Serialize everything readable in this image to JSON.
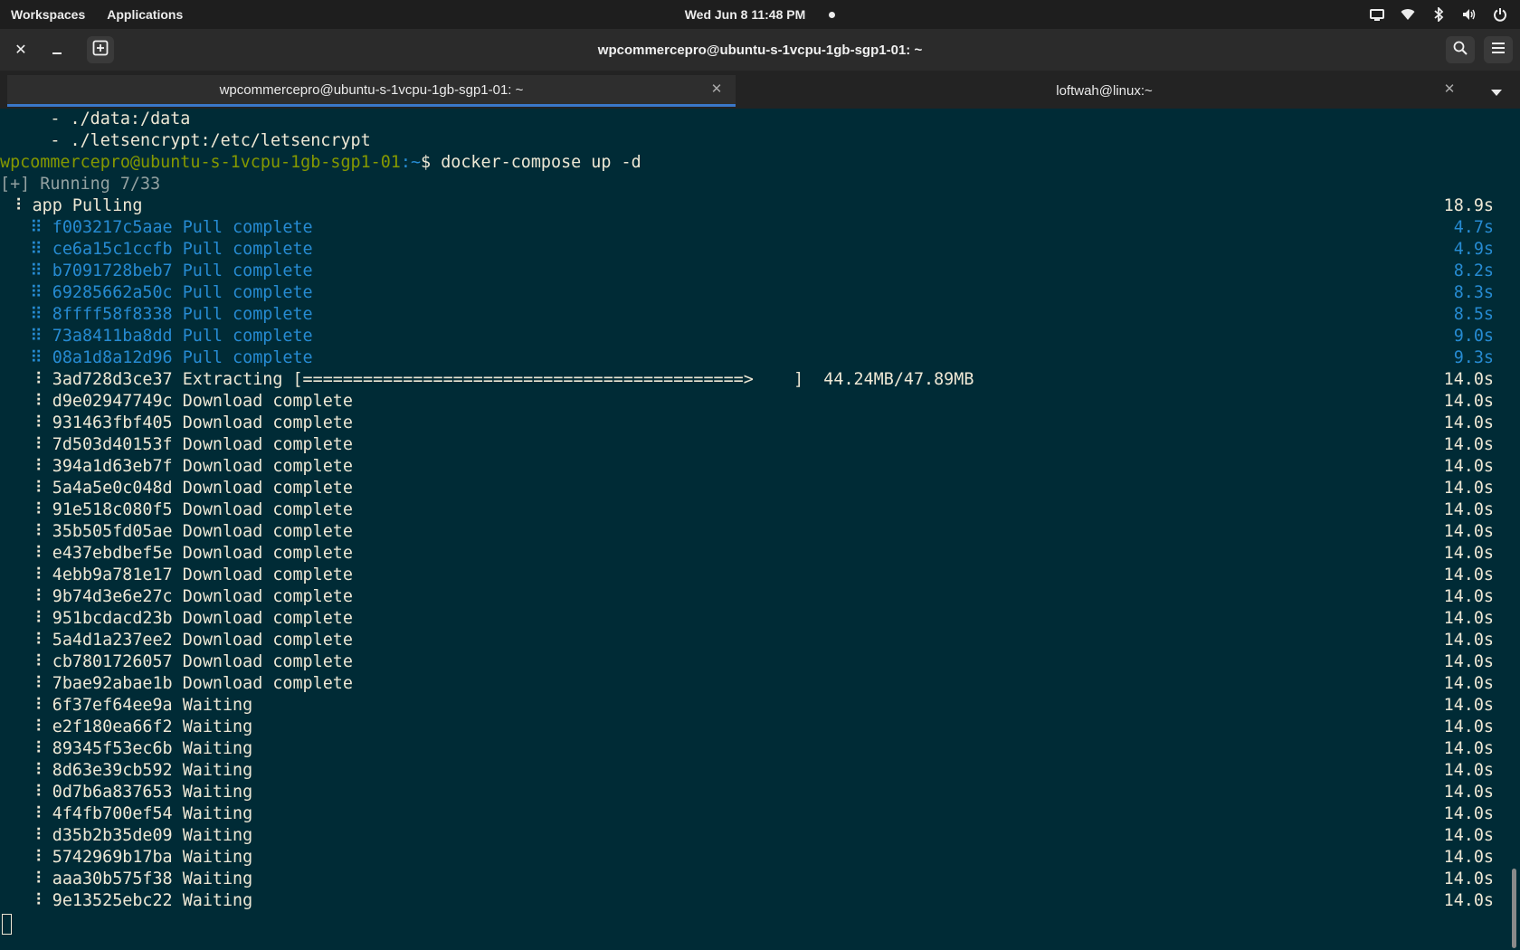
{
  "topbar": {
    "workspaces": "Workspaces",
    "applications": "Applications",
    "clock": "Wed Jun 8  11:48 PM",
    "tray_icons": [
      "screen-icon",
      "wifi-icon",
      "bluetooth-icon",
      "volume-icon",
      "power-icon"
    ]
  },
  "window": {
    "title": "wpcommercepro@ubuntu-s-1vcpu-1gb-sgp1-01: ~",
    "buttons": [
      "close-icon",
      "minimize-icon",
      "new-tab-icon",
      "search-icon",
      "menu-icon"
    ]
  },
  "tabs": [
    {
      "label": "wpcommercepro@ubuntu-s-1vcpu-1gb-sgp1-01: ~",
      "active": true
    },
    {
      "label": "loftwah@linux:~",
      "active": false
    }
  ],
  "colors": {
    "background": "#002b36",
    "blue": "#268bd2",
    "green": "#859900",
    "text": "#eee8d5",
    "accent": "#3a78c9"
  },
  "terminal": {
    "pre_lines": [
      "     - ./data:/data",
      "     - ./letsencrypt:/etc/letsencrypt"
    ],
    "prompt_user": "wpcommercepro@ubuntu-s-1vcpu-1gb-sgp1-01",
    "prompt_path": ":~",
    "prompt_sigil": "$ ",
    "command": "docker-compose up -d",
    "running": "[+] Running 7/33",
    "app_line": " ⠸ app Pulling",
    "app_time": "18.9s",
    "layers": [
      {
        "text": "   ⠿ f003217c5aae Pull complete",
        "time": "4.7s",
        "style": "blue"
      },
      {
        "text": "   ⠿ ce6a15c1ccfb Pull complete",
        "time": "4.9s",
        "style": "blue"
      },
      {
        "text": "   ⠿ b7091728beb7 Pull complete",
        "time": "8.2s",
        "style": "blue"
      },
      {
        "text": "   ⠿ 69285662a50c Pull complete",
        "time": "8.3s",
        "style": "blue"
      },
      {
        "text": "   ⠿ 8ffff58f8338 Pull complete",
        "time": "8.5s",
        "style": "blue"
      },
      {
        "text": "   ⠿ 73a8411ba8dd Pull complete",
        "time": "9.0s",
        "style": "blue"
      },
      {
        "text": "   ⠿ 08a1d8a12d96 Pull complete",
        "time": "9.3s",
        "style": "blue"
      },
      {
        "text": "   ⠸ 3ad728d3ce37 Extracting [============================================>    ]  44.24MB/47.89MB",
        "time": "14.0s",
        "style": "plain"
      },
      {
        "text": "   ⠸ d9e02947749c Download complete",
        "time": "14.0s",
        "style": "plain"
      },
      {
        "text": "   ⠸ 931463fbf405 Download complete",
        "time": "14.0s",
        "style": "plain"
      },
      {
        "text": "   ⠸ 7d503d40153f Download complete",
        "time": "14.0s",
        "style": "plain"
      },
      {
        "text": "   ⠸ 394a1d63eb7f Download complete",
        "time": "14.0s",
        "style": "plain"
      },
      {
        "text": "   ⠸ 5a4a5e0c048d Download complete",
        "time": "14.0s",
        "style": "plain"
      },
      {
        "text": "   ⠸ 91e518c080f5 Download complete",
        "time": "14.0s",
        "style": "plain"
      },
      {
        "text": "   ⠸ 35b505fd05ae Download complete",
        "time": "14.0s",
        "style": "plain"
      },
      {
        "text": "   ⠸ e437ebdbef5e Download complete",
        "time": "14.0s",
        "style": "plain"
      },
      {
        "text": "   ⠸ 4ebb9a781e17 Download complete",
        "time": "14.0s",
        "style": "plain"
      },
      {
        "text": "   ⠸ 9b74d3e6e27c Download complete",
        "time": "14.0s",
        "style": "plain"
      },
      {
        "text": "   ⠸ 951bcdacd23b Download complete",
        "time": "14.0s",
        "style": "plain"
      },
      {
        "text": "   ⠸ 5a4d1a237ee2 Download complete",
        "time": "14.0s",
        "style": "plain"
      },
      {
        "text": "   ⠸ cb7801726057 Download complete",
        "time": "14.0s",
        "style": "plain"
      },
      {
        "text": "   ⠸ 7bae92abae1b Download complete",
        "time": "14.0s",
        "style": "plain"
      },
      {
        "text": "   ⠸ 6f37ef64ee9a Waiting",
        "time": "14.0s",
        "style": "plain"
      },
      {
        "text": "   ⠸ e2f180ea66f2 Waiting",
        "time": "14.0s",
        "style": "plain"
      },
      {
        "text": "   ⠸ 89345f53ec6b Waiting",
        "time": "14.0s",
        "style": "plain"
      },
      {
        "text": "   ⠸ 8d63e39cb592 Waiting",
        "time": "14.0s",
        "style": "plain"
      },
      {
        "text": "   ⠸ 0d7b6a837653 Waiting",
        "time": "14.0s",
        "style": "plain"
      },
      {
        "text": "   ⠸ 4f4fb700ef54 Waiting",
        "time": "14.0s",
        "style": "plain"
      },
      {
        "text": "   ⠸ d35b2b35de09 Waiting",
        "time": "14.0s",
        "style": "plain"
      },
      {
        "text": "   ⠸ 5742969b17ba Waiting",
        "time": "14.0s",
        "style": "plain"
      },
      {
        "text": "   ⠸ aaa30b575f38 Waiting",
        "time": "14.0s",
        "style": "plain"
      },
      {
        "text": "   ⠸ 9e13525ebc22 Waiting",
        "time": "14.0s",
        "style": "plain"
      }
    ]
  }
}
